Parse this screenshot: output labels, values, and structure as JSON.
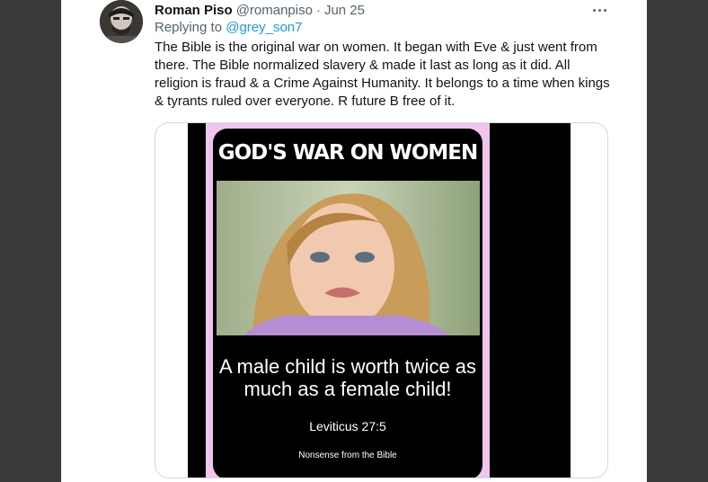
{
  "tweet": {
    "author": {
      "display_name": "Roman Piso",
      "handle": "@romanpiso",
      "separator": "·",
      "date": "Jun 25"
    },
    "replying_prefix": "Replying to",
    "replying_to": "@grey_son7",
    "text": "The Bible is the original war on women. It began with Eve & just went from there. The Bible normalized slavery & made it last as long as it did. All religion is fraud & a Crime Against Humanity. It belongs to a time when kings & tyrants ruled over everyone. R future B free of it.",
    "icons": [
      "avatar",
      "more-options-icon"
    ],
    "media": {
      "title": "GOD'S WAR ON WOMEN",
      "claim": "A male child is worth twice as much as a female child!",
      "citation": "Leviticus 27:5",
      "source": "Nonsense from the Bible"
    }
  },
  "colors": {
    "text_primary": "#0f1419",
    "text_secondary": "#536471",
    "link": "#1d9bf0",
    "poster_frame": "#f0c4ee"
  }
}
